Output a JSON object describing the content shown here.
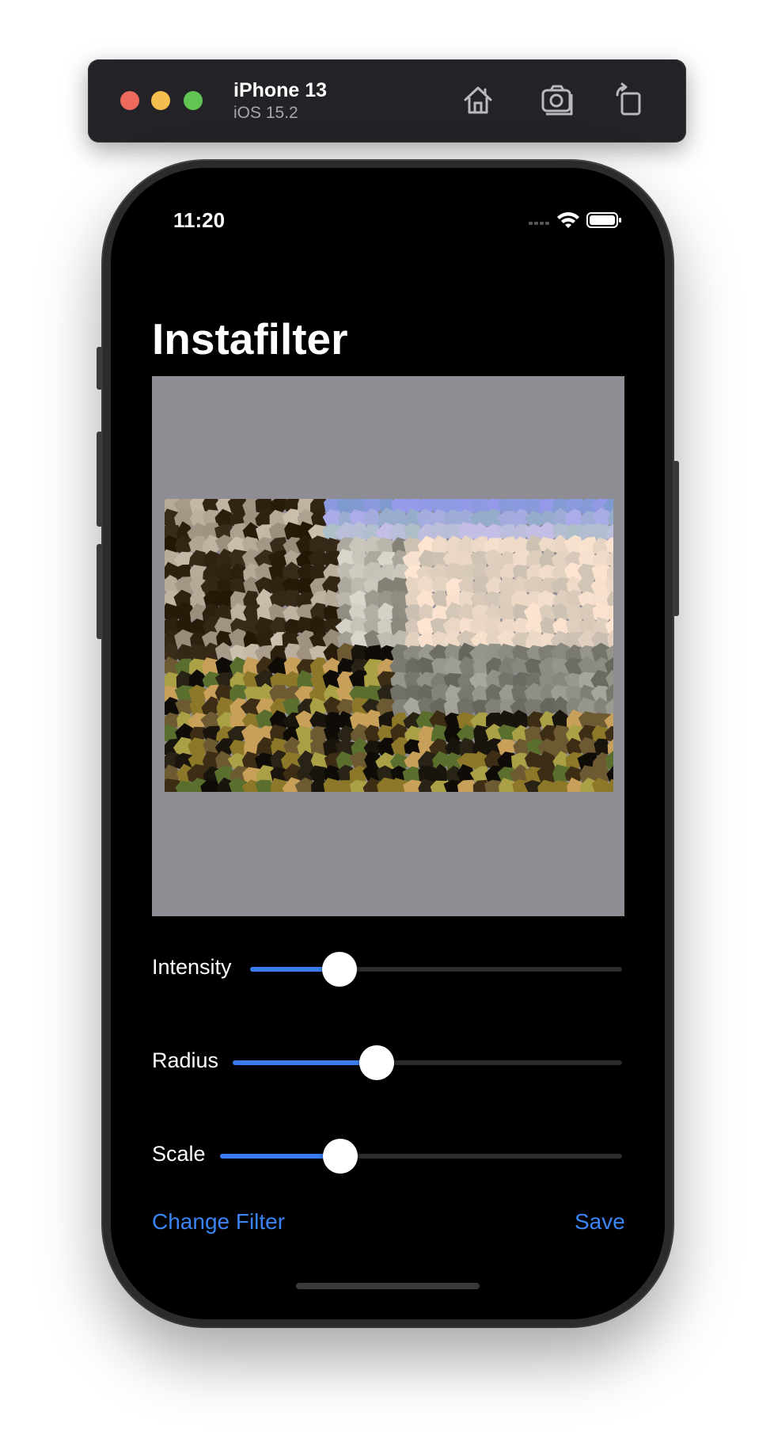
{
  "simulator": {
    "device_name": "iPhone 13",
    "os_version": "iOS 15.2",
    "toolbar_icons": [
      "home-icon",
      "screenshot-camera-icon",
      "rotate-icon"
    ]
  },
  "status_bar": {
    "time": "11:20",
    "icons": [
      "cellular-icon",
      "wifi-icon",
      "battery-icon"
    ]
  },
  "app": {
    "title": "Instafilter",
    "image_description_icon": "filtered-photo",
    "sliders": [
      {
        "label": "Intensity",
        "value": 0.24
      },
      {
        "label": "Radius",
        "value": 0.37
      },
      {
        "label": "Scale",
        "value": 0.3
      }
    ],
    "change_filter_label": "Change Filter",
    "save_label": "Save"
  },
  "colors": {
    "accent": "#3a84f5",
    "slider_fill": "#3a7cf0",
    "image_background": "#8e8d93"
  }
}
